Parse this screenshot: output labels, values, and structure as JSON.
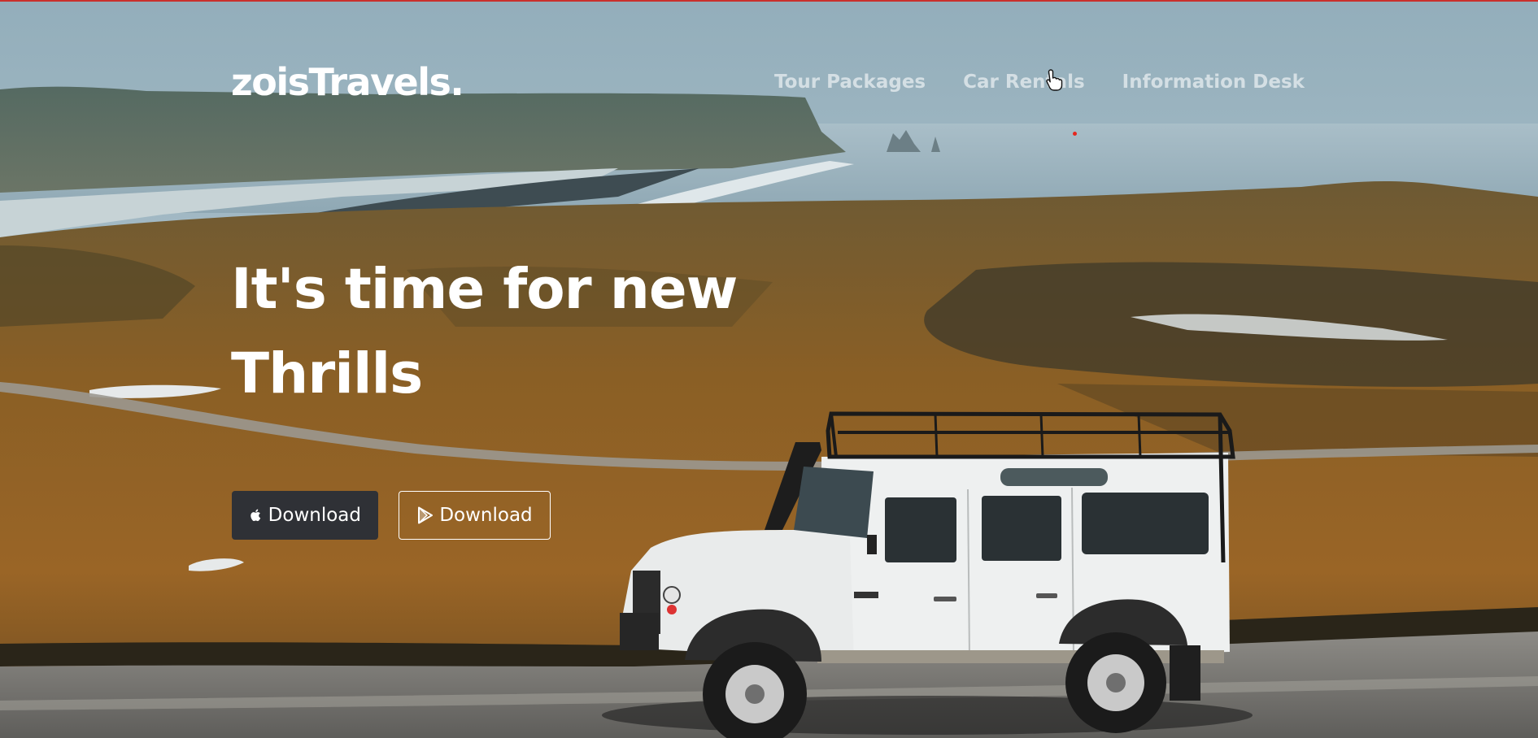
{
  "brand": {
    "name": "zoisTravels."
  },
  "nav": {
    "links": [
      "Tour Packages",
      "Car Rentals",
      "Information Desk"
    ]
  },
  "hero": {
    "headline_line1": "It's time for new",
    "headline_line2": "Thrills",
    "buttons": [
      {
        "label": "Download",
        "icon": "apple-icon"
      },
      {
        "label": "Download",
        "icon": "play-store-icon"
      }
    ],
    "image_subject": "white-off-road-vehicle-on-coastal-gravel-road"
  },
  "colors": {
    "accent_dot": "#e5271f",
    "top_border": "#c9302c",
    "button_dark": "#2f3136",
    "text": "#ffffff"
  }
}
